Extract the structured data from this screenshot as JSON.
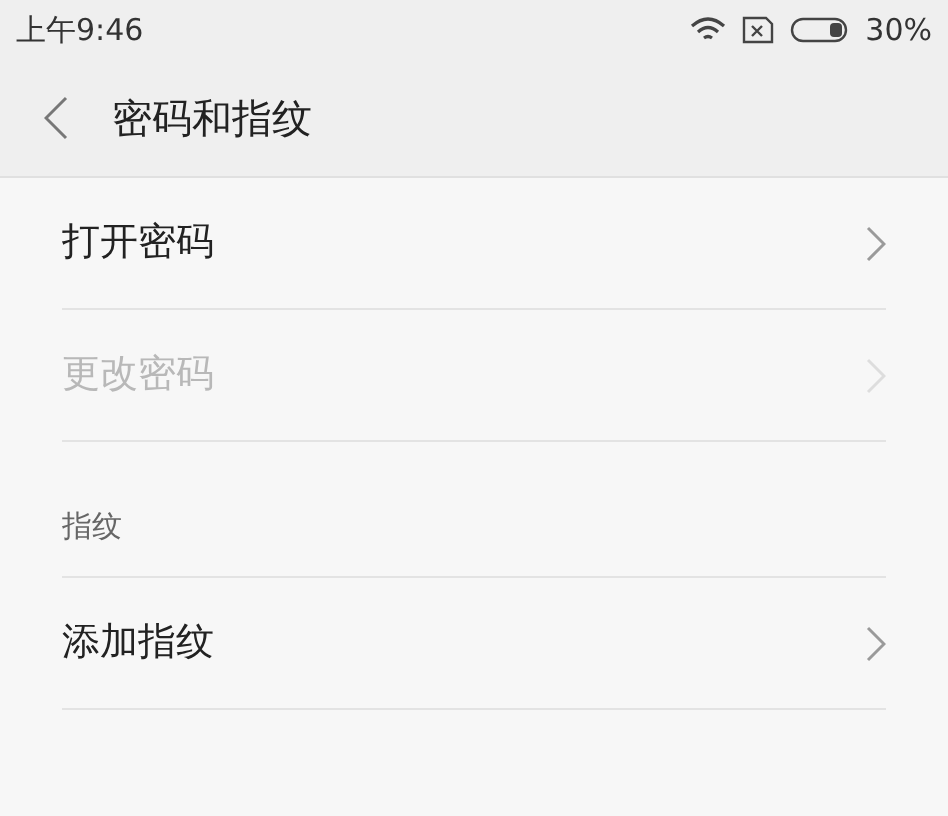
{
  "status_bar": {
    "time": "上午9:46",
    "battery": "30%"
  },
  "header": {
    "title": "密码和指纹"
  },
  "items": [
    {
      "kind": "row",
      "label": "打开密码",
      "disabled": false
    },
    {
      "kind": "row",
      "label": "更改密码",
      "disabled": true
    },
    {
      "kind": "section",
      "label": "指纹"
    },
    {
      "kind": "row",
      "label": "添加指纹",
      "disabled": false
    }
  ]
}
